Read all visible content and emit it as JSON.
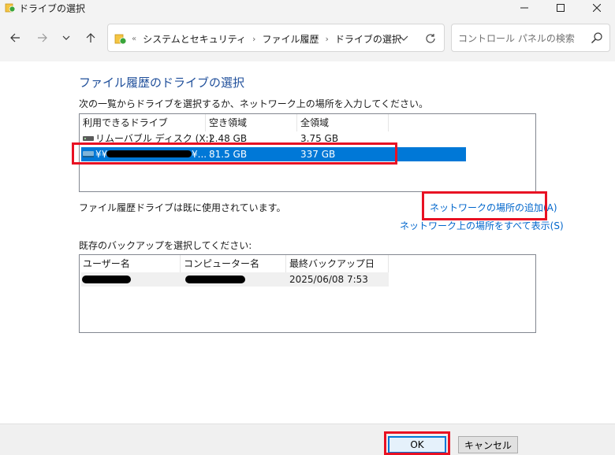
{
  "window": {
    "title": "ドライブの選択"
  },
  "nav": {
    "breadcrumb_overflow": "«",
    "crumbs": [
      "システムとセキュリティ",
      "ファイル履歴",
      "ドライブの選択"
    ],
    "separator": "›"
  },
  "search": {
    "placeholder": "コントロール パネルの検索"
  },
  "main": {
    "heading": "ファイル履歴のドライブの選択",
    "instruction": "次の一覧からドライブを選択するか、ネットワーク上の場所を入力してください。",
    "drive_columns": [
      "利用できるドライブ",
      "空き領域",
      "全領域"
    ],
    "drives": [
      {
        "name": "リムーバブル ディスク (X:)",
        "free": "2.48 GB",
        "total": "3.75 GB",
        "selected": false
      },
      {
        "name_prefix": "¥¥",
        "name_suffix": "¥...",
        "free": "81.5 GB",
        "total": "337 GB",
        "selected": true
      }
    ],
    "status": "ファイル履歴ドライブは既に使用されています。",
    "add_network_link": "ネットワークの場所の追加(A)",
    "show_all_network_link": "ネットワーク上の場所をすべて表示(S)",
    "backup_label": "既存のバックアップを選択してください:",
    "backup_columns": [
      "ユーザー名",
      "コンピューター名",
      "最終バックアップ日"
    ],
    "backups": [
      {
        "date": "2025/06/08 7:53"
      }
    ]
  },
  "footer": {
    "ok_label": "OK",
    "cancel_label": "キャンセル"
  },
  "colors": {
    "accent": "#0078d7",
    "highlight_red": "#e81123",
    "heading_blue": "#1e4e9a",
    "link_blue": "#0066cc"
  }
}
